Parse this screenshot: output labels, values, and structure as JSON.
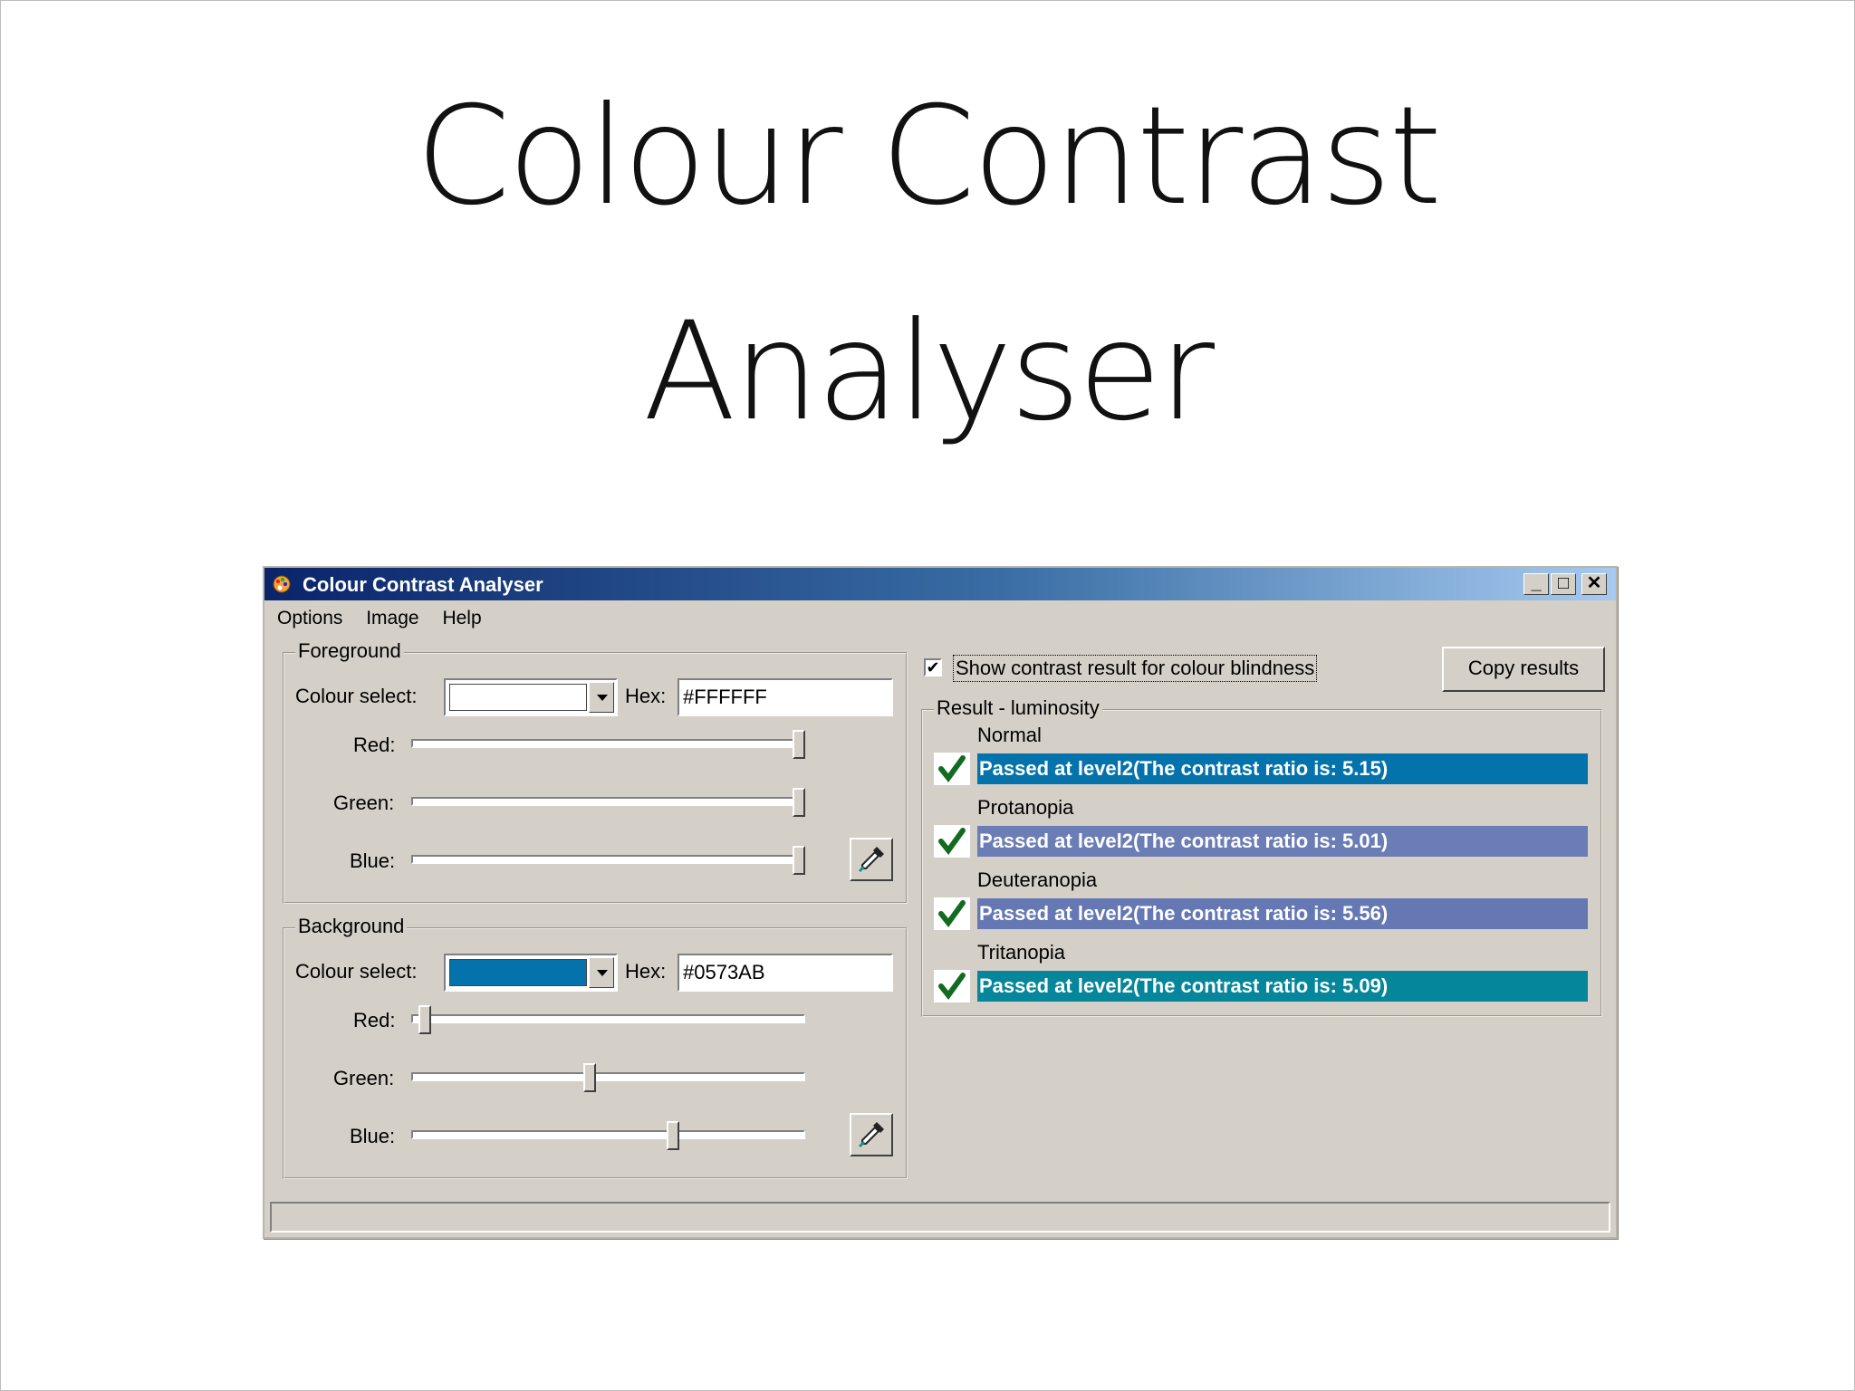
{
  "slide": {
    "title_line1": "Colour Contrast",
    "title_line2": "Analyser"
  },
  "window": {
    "title": "Colour Contrast Analyser",
    "controls": {
      "minimize": "_",
      "maximize": "□",
      "close": "✕"
    },
    "icon": "palette-icon"
  },
  "menu": [
    {
      "label": "Options"
    },
    {
      "label": "Image"
    },
    {
      "label": "Help"
    }
  ],
  "foreground": {
    "legend": "Foreground",
    "colour_select_label": "Colour select:",
    "swatch_color": "#FFFFFF",
    "hex_label": "Hex:",
    "hex_value": "#FFFFFF",
    "red_label": "Red:",
    "green_label": "Green:",
    "blue_label": "Blue:",
    "red": 255,
    "green": 255,
    "blue": 255
  },
  "background": {
    "legend": "Background",
    "colour_select_label": "Colour select:",
    "swatch_color": "#0573AB",
    "hex_label": "Hex:",
    "hex_value": "#0573AB",
    "red_label": "Red:",
    "green_label": "Green:",
    "blue_label": "Blue:",
    "red": 5,
    "green": 115,
    "blue": 171
  },
  "options": {
    "show_colour_blindness_label": "Show contrast result for colour blindness",
    "show_colour_blindness_checked": "✔",
    "copy_results_label": "Copy results"
  },
  "results": {
    "legend": "Result - luminosity",
    "items": [
      {
        "title": "Normal",
        "text": "Passed at level2(The contrast ratio is: 5.15)",
        "color": "#0573AB"
      },
      {
        "title": "Protanopia",
        "text": "Passed at level2(The contrast ratio is: 5.01)",
        "color": "#6B7DB5"
      },
      {
        "title": "Deuteranopia",
        "text": "Passed at level2(The contrast ratio is: 5.56)",
        "color": "#6578B3"
      },
      {
        "title": "Tritanopia",
        "text": "Passed at level2(The contrast ratio is: 5.09)",
        "color": "#05869A"
      }
    ],
    "pass_icon": "checkmark-icon"
  },
  "status_bar": ""
}
